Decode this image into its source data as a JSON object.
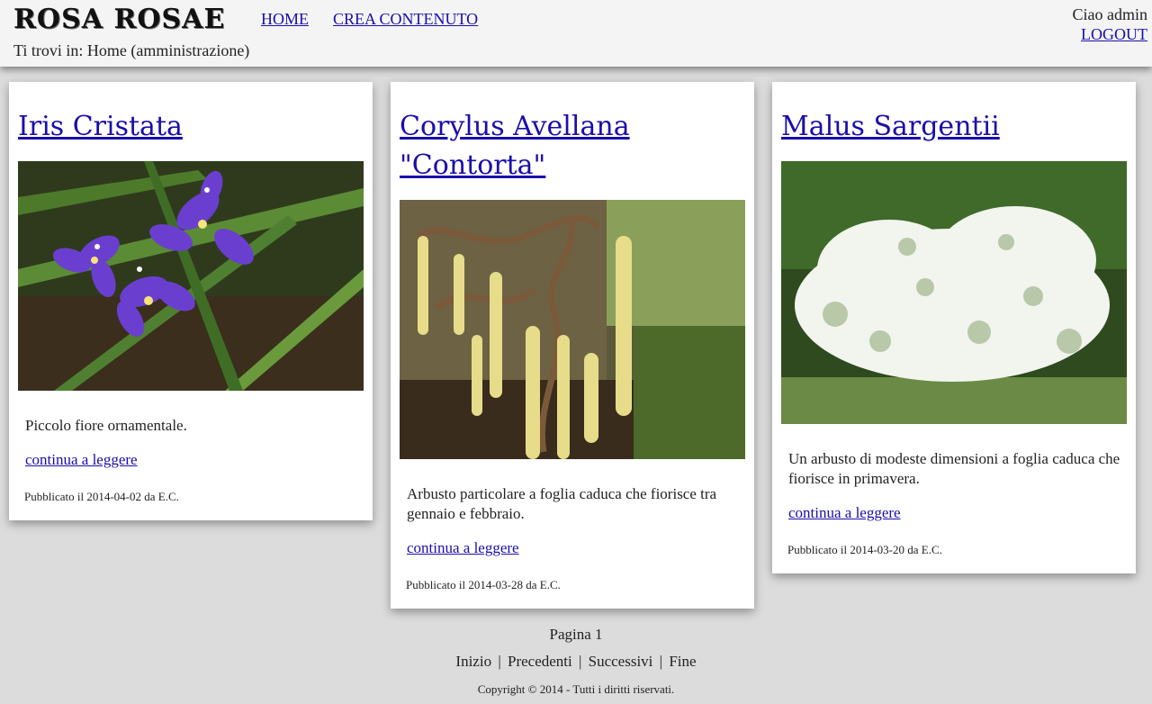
{
  "header": {
    "logo": "ROSA ROSAE",
    "nav": {
      "home": "HOME",
      "create": "CREA CONTENUTO"
    },
    "breadcrumb": "Ti trovi in: Home (amministrazione)",
    "greeting": "Ciao admin",
    "logout": "LOGOUT"
  },
  "cards": [
    {
      "title": "Iris Cristata",
      "summary": "Piccolo fiore ornamentale.",
      "read_more": "continua a leggere",
      "meta": "Pubblicato il 2014-04-02 da E.C."
    },
    {
      "title": "Corylus Avellana \"Contorta\"",
      "summary": "Arbusto particolare a foglia caduca che fiorisce tra gennaio e febbraio.",
      "read_more": "continua a leggere",
      "meta": "Pubblicato il 2014-03-28 da E.C."
    },
    {
      "title": "Malus Sargentii",
      "summary": "Un arbusto di modeste dimensioni a foglia caduca che fiorisce in primavera.",
      "read_more": "continua a leggere",
      "meta": "Pubblicato il 2014-03-20 da E.C."
    }
  ],
  "pagination": {
    "label": "Pagina 1",
    "first": "Inizio",
    "prev": "Precedenti",
    "next": "Successivi",
    "last": "Fine",
    "separator": "|"
  },
  "footer": {
    "copyright": "Copyright © 2014 - Tutti i diritti riservati."
  }
}
